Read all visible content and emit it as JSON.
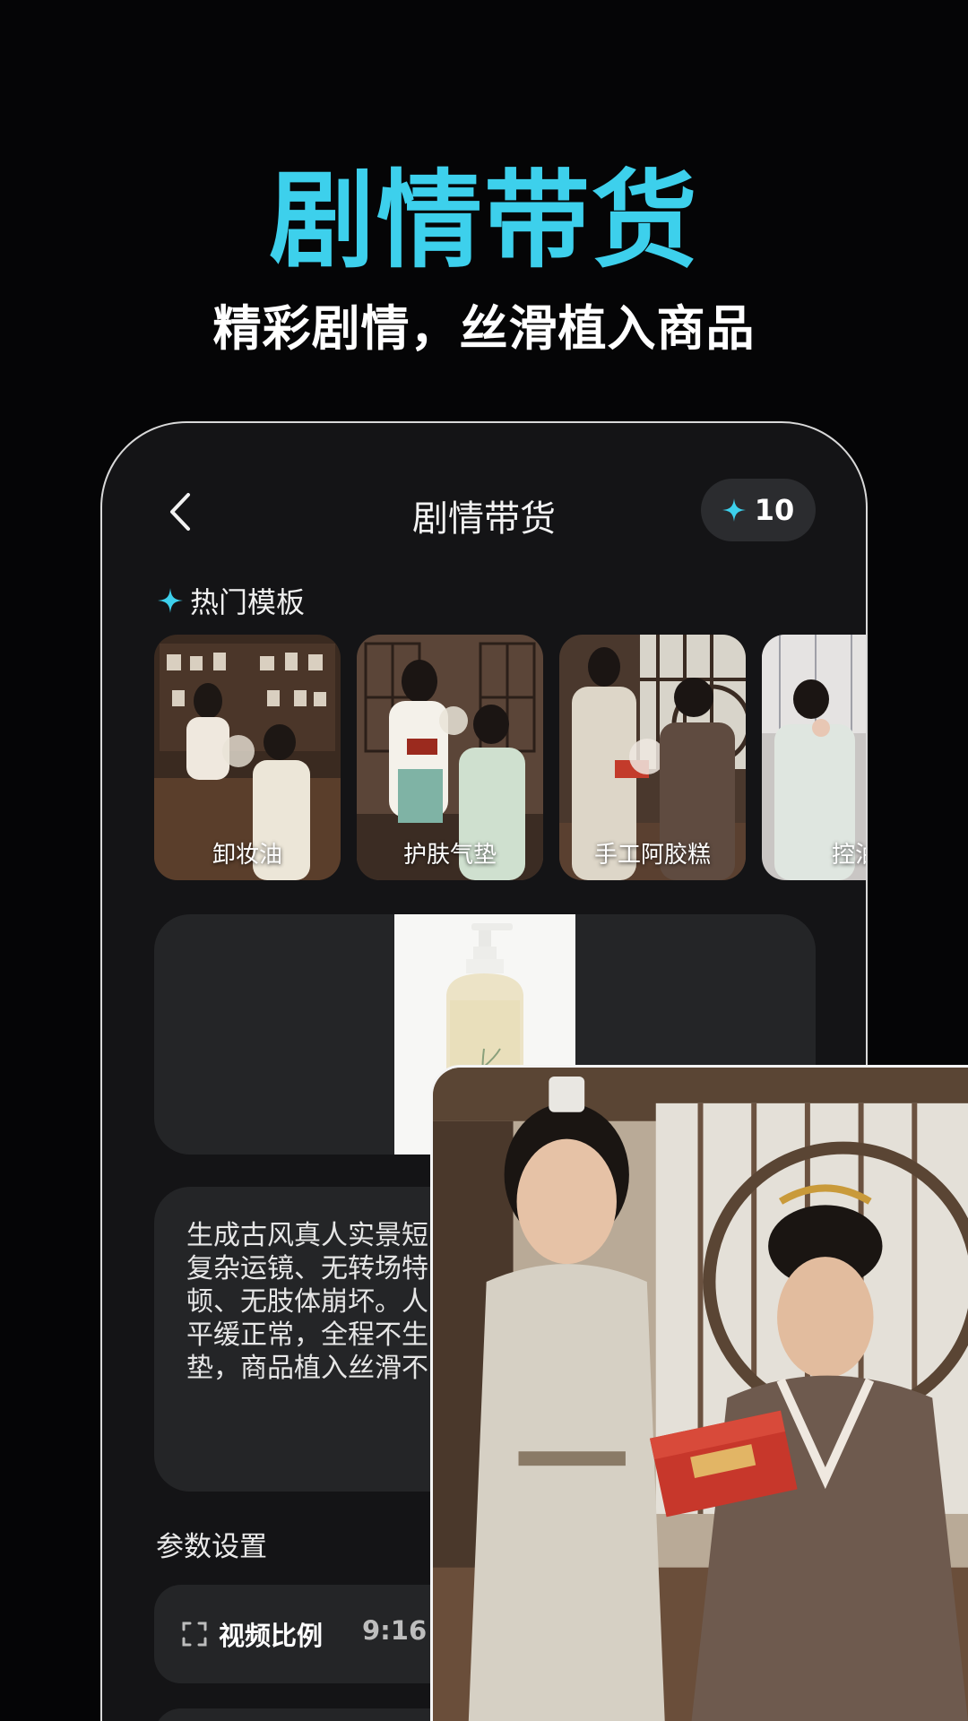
{
  "hero": {
    "title": "剧情带货",
    "subtitle": "精彩剧情，丝滑植入商品"
  },
  "app": {
    "title": "剧情带货",
    "credits": "10",
    "accent_color": "#3dd0ec"
  },
  "templates_section": {
    "label": "热门模板",
    "items": [
      {
        "label": "卸妆油"
      },
      {
        "label": "护肤气垫"
      },
      {
        "label": "手工阿胶糕"
      },
      {
        "label": "控油"
      }
    ]
  },
  "prompt": {
    "text": "生成古风真人实景短\n复杂运镜、无转场特\n顿、无肢体崩坏。人\n平缓正常，全程不生\n垫，商品植入丝滑不"
  },
  "params": {
    "label": "参数设置",
    "ratio_label": "视频比例",
    "ratio_value": "9:16"
  }
}
